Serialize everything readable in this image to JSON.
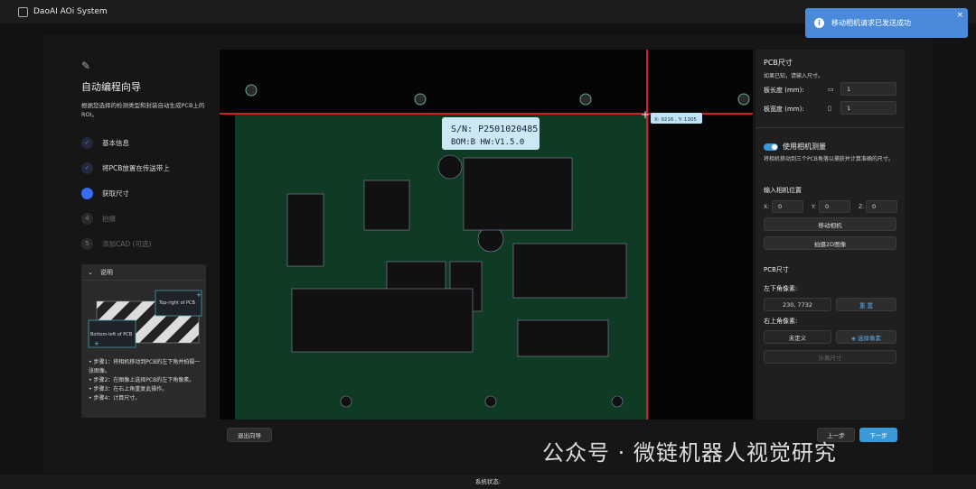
{
  "app": {
    "title": "DaoAI AOi System"
  },
  "toast": {
    "message": "移动相机请求已发送成功",
    "icon": "info-icon"
  },
  "wizard": {
    "title": "自动编程向导",
    "description": "根据您选择的检测类型和封装自动生成PCB上的ROI。",
    "steps": [
      {
        "num": "1",
        "label": "基本信息",
        "state": "done"
      },
      {
        "num": "2",
        "label": "将PCB放置在传送带上",
        "state": "done"
      },
      {
        "num": "3",
        "label": "获取尺寸",
        "state": "current"
      },
      {
        "num": "4",
        "label": "拍摄",
        "state": "todo"
      },
      {
        "num": "5",
        "label": "添加CAD (可选)",
        "state": "todo"
      }
    ],
    "exit_label": "退出向导"
  },
  "notes": {
    "title": "说明",
    "diagram": {
      "top_right": "Top-right of PCB",
      "bottom_left": "Bottom-left of PCB"
    },
    "items": [
      "步骤1：将相机移动到PCB的左下角并拍摄一张图像。",
      "步骤2：在图像上选择PCB的左下角像素。",
      "步骤3：在右上角重复此操作。",
      "步骤4：计算尺寸。"
    ]
  },
  "viewer": {
    "label_sn": "S/N: P2501020485",
    "label_bom": "BOM:B   HW:V1.5.0",
    "cursor_readout": "X: 9216 , Y: 1305",
    "colors": {
      "board": "#0f3b25",
      "crosshair": "#d02020"
    }
  },
  "pcb_size": {
    "title": "PCB尺寸",
    "hint": "如果已知，请输入尺寸。",
    "length_label": "板长度 (mm):",
    "length_value": "1",
    "width_label": "板宽度 (mm):",
    "width_value": "1"
  },
  "camera": {
    "toggle_label": "使用相机测量",
    "toggle_on": true,
    "desc": "将相机移动到三个PCB角落以捕获并计算准确的尺寸。",
    "pos_title": "输入相机位置",
    "x_label": "X:",
    "x": "0",
    "y_label": "Y:",
    "y": "0",
    "z_label": "Z:",
    "z": "0",
    "move_label": "移动相机",
    "capture_label": "拍摄2D图像"
  },
  "measure": {
    "title": "PCB尺寸",
    "bl_label": "左下角像素:",
    "bl_value": "230, 7732",
    "reset_label": "重 置",
    "tr_label": "右上角像素:",
    "tr_value": "未定义",
    "select_label": "◈ 选择像素",
    "calc_label": "计算尺寸"
  },
  "nav": {
    "prev_label": "上一步",
    "next_label": "下一步"
  },
  "status": {
    "label": "系统状态:"
  },
  "watermark": "公众号 · 微链机器人视觉研究"
}
